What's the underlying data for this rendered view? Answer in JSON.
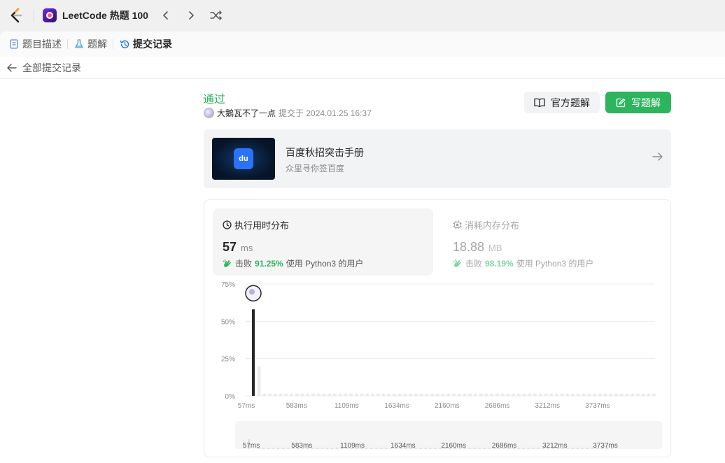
{
  "nav": {
    "list_title": "LeetCode 热题 100"
  },
  "tabs": [
    {
      "label": "题目描述"
    },
    {
      "label": "题解"
    },
    {
      "label": "提交记录"
    }
  ],
  "back_label": "全部提交记录",
  "submission": {
    "status": "通过",
    "user": "大鵝瓦不了一点",
    "submitted_text": "提交于 2024.01.25 16:37"
  },
  "actions": {
    "official_label": "官方题解",
    "write_label": "写题解"
  },
  "banner": {
    "title": "百度秋招突击手册",
    "subtitle": "众里寻你签百度",
    "logo_text": "du"
  },
  "runtime": {
    "title": "执行用时分布",
    "value": "57",
    "unit": "ms",
    "beat_prefix": "击败",
    "beat_pct": "91.25%",
    "beat_suffix": "使用 Python3 的用户"
  },
  "memory": {
    "title": "消耗内存分布",
    "value": "18.88",
    "unit": "MB",
    "beat_prefix": "击败",
    "beat_pct": "98.19%",
    "beat_suffix": "使用 Python3 的用户"
  },
  "chart_data": {
    "type": "bar",
    "ylim": [
      0,
      75
    ],
    "yticks": [
      "0%",
      "25%",
      "50%",
      "75%"
    ],
    "xticks": [
      "57ms",
      "583ms",
      "1109ms",
      "1634ms",
      "2160ms",
      "2686ms",
      "3212ms",
      "3737ms"
    ],
    "highlight_index": 0,
    "values": [
      58,
      20,
      1.5,
      1.5,
      1.5,
      1.5,
      1.5,
      1.5,
      1.5,
      1.5,
      1.5,
      1.5,
      1.5,
      1.5,
      1.5,
      1.5,
      1.5,
      1.5,
      1.5,
      1.5,
      1.5,
      1.5,
      1.5,
      1.5,
      1.5,
      1.5,
      1.5,
      1.5,
      1.5,
      1.5,
      1.5,
      1.5,
      1.5,
      1.5,
      1.5,
      1.5,
      1.5,
      1.5,
      1.5,
      1.5,
      1.5,
      1.5,
      1.5,
      1.5,
      1.5,
      1.5,
      1.5,
      1.5,
      1.5,
      1.5,
      1.5,
      1.5,
      1.5,
      1.5,
      1.5,
      1.5,
      1.5,
      1.5,
      1.5,
      1.5,
      1.5,
      1.5,
      1.5,
      1.5,
      1.5,
      1.5,
      1.5,
      1.5,
      1.5,
      1.5,
      1.5,
      1.5,
      1.5,
      1.5,
      1.5
    ],
    "colors": {
      "highlight": "#262626",
      "normal": "#ebebeb",
      "grid": "#ececec"
    }
  }
}
